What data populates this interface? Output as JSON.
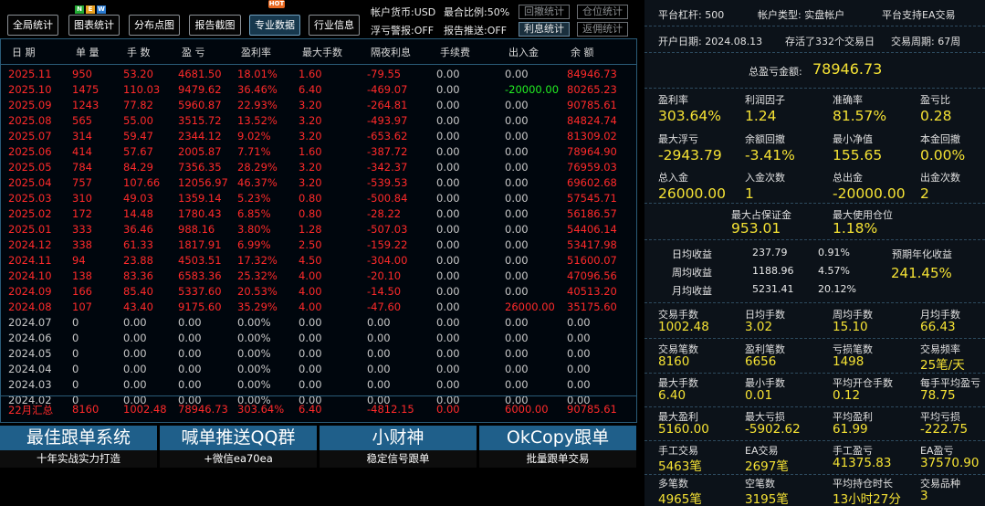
{
  "toolbar": {
    "buttons": [
      "全局统计",
      "图表统计",
      "分布点图",
      "报告截图",
      "专业数据",
      "行业信息"
    ],
    "active_index": 4,
    "new_badge": [
      "N",
      "E",
      "W"
    ],
    "hot_badge": "HOT",
    "currency": "帐户货币:USD",
    "ratio": "最合比例:50%",
    "float_warn": "浮亏警报:OFF",
    "report_push": "报告推送:OFF",
    "btn_test": "回撤统计",
    "btn_position": "仓位统计",
    "btn_interest": "利息统计",
    "btn_return": "返佣统计"
  },
  "table": {
    "headers": [
      "日 期",
      "单 量",
      "手 数",
      "盈 亏",
      "盈利率",
      "最大手数",
      "隔夜利息",
      "手续费",
      "出入金",
      "余 额"
    ],
    "rows": [
      [
        "2025.11",
        "950",
        "53.20",
        "4681.50",
        "18.01%",
        "1.60",
        "-79.55",
        "0.00",
        "0.00",
        "84946.73"
      ],
      [
        "2025.10",
        "1475",
        "110.03",
        "9479.62",
        "36.46%",
        "6.40",
        "-469.07",
        "0.00",
        "-20000.00",
        "80265.23"
      ],
      [
        "2025.09",
        "1243",
        "77.82",
        "5960.87",
        "22.93%",
        "3.20",
        "-264.81",
        "0.00",
        "0.00",
        "90785.61"
      ],
      [
        "2025.08",
        "565",
        "55.00",
        "3515.72",
        "13.52%",
        "3.20",
        "-493.97",
        "0.00",
        "0.00",
        "84824.74"
      ],
      [
        "2025.07",
        "314",
        "59.47",
        "2344.12",
        "9.02%",
        "3.20",
        "-653.62",
        "0.00",
        "0.00",
        "81309.02"
      ],
      [
        "2025.06",
        "414",
        "57.67",
        "2005.87",
        "7.71%",
        "1.60",
        "-387.72",
        "0.00",
        "0.00",
        "78964.90"
      ],
      [
        "2025.05",
        "784",
        "84.29",
        "7356.35",
        "28.29%",
        "3.20",
        "-342.37",
        "0.00",
        "0.00",
        "76959.03"
      ],
      [
        "2025.04",
        "757",
        "107.66",
        "12056.97",
        "46.37%",
        "3.20",
        "-539.53",
        "0.00",
        "0.00",
        "69602.68"
      ],
      [
        "2025.03",
        "310",
        "49.03",
        "1359.14",
        "5.23%",
        "0.80",
        "-500.84",
        "0.00",
        "0.00",
        "57545.71"
      ],
      [
        "2025.02",
        "172",
        "14.48",
        "1780.43",
        "6.85%",
        "0.80",
        "-28.22",
        "0.00",
        "0.00",
        "56186.57"
      ],
      [
        "2025.01",
        "333",
        "36.46",
        "988.16",
        "3.80%",
        "1.28",
        "-507.03",
        "0.00",
        "0.00",
        "54406.14"
      ],
      [
        "2024.12",
        "338",
        "61.33",
        "1817.91",
        "6.99%",
        "2.50",
        "-159.22",
        "0.00",
        "0.00",
        "53417.98"
      ],
      [
        "2024.11",
        "94",
        "23.88",
        "4503.51",
        "17.32%",
        "4.50",
        "-304.00",
        "0.00",
        "0.00",
        "51600.07"
      ],
      [
        "2024.10",
        "138",
        "83.36",
        "6583.36",
        "25.32%",
        "4.00",
        "-20.10",
        "0.00",
        "0.00",
        "47096.56"
      ],
      [
        "2024.09",
        "166",
        "85.40",
        "5337.60",
        "20.53%",
        "4.00",
        "-14.50",
        "0.00",
        "0.00",
        "40513.20"
      ],
      [
        "2024.08",
        "107",
        "43.40",
        "9175.60",
        "35.29%",
        "4.00",
        "-47.60",
        "0.00",
        "26000.00",
        "35175.60"
      ],
      [
        "2024.07",
        "0",
        "0.00",
        "0.00",
        "0.00%",
        "0.00",
        "0.00",
        "0.00",
        "0.00",
        "0.00"
      ],
      [
        "2024.06",
        "0",
        "0.00",
        "0.00",
        "0.00%",
        "0.00",
        "0.00",
        "0.00",
        "0.00",
        "0.00"
      ],
      [
        "2024.05",
        "0",
        "0.00",
        "0.00",
        "0.00%",
        "0.00",
        "0.00",
        "0.00",
        "0.00",
        "0.00"
      ],
      [
        "2024.04",
        "0",
        "0.00",
        "0.00",
        "0.00%",
        "0.00",
        "0.00",
        "0.00",
        "0.00",
        "0.00"
      ],
      [
        "2024.03",
        "0",
        "0.00",
        "0.00",
        "0.00%",
        "0.00",
        "0.00",
        "0.00",
        "0.00",
        "0.00"
      ],
      [
        "2024.02",
        "0",
        "0.00",
        "0.00",
        "0.00%",
        "0.00",
        "0.00",
        "0.00",
        "0.00",
        "0.00"
      ]
    ],
    "summary": [
      "22月汇总",
      "8160",
      "1002.48",
      "78946.73",
      "303.64%",
      "6.40",
      "-4812.15",
      "0.00",
      "6000.00",
      "90785.61"
    ]
  },
  "ads": [
    {
      "title": "最佳跟单系统",
      "sub": "十年实战实力打造"
    },
    {
      "title": "喊单推送QQ群",
      "sub": "+微信ea70ea"
    },
    {
      "title": "小财神",
      "sub": "稳定信号跟单"
    },
    {
      "title": "OkCopy跟单",
      "sub": "批量跟单交易"
    }
  ],
  "right": {
    "leverage": "平台杠杆:  500",
    "acct_type": "帐户类型:  实盘帐户",
    "ea_support": "平台支持EA交易",
    "open_date": "开户日期:  2024.08.13",
    "survived": "存活了332个交易日",
    "period": "交易周期:  67周",
    "total_profit_label": "总盈亏金额:",
    "total_profit": "78946.73",
    "stats1": [
      {
        "label": "盈利率",
        "value": "303.64%"
      },
      {
        "label": "利润因子",
        "value": "1.24"
      },
      {
        "label": "准确率",
        "value": "81.57%"
      },
      {
        "label": "盈亏比",
        "value": "0.28"
      },
      {
        "label": "最大浮亏",
        "value": "-2943.79"
      },
      {
        "label": "余额回撤",
        "value": "-3.41%"
      },
      {
        "label": "最小净值",
        "value": "155.65"
      },
      {
        "label": "本金回撤",
        "value": "0.00%"
      },
      {
        "label": "总入金",
        "value": "26000.00"
      },
      {
        "label": "入金次数",
        "value": "1"
      },
      {
        "label": "总出金",
        "value": "-20000.00"
      },
      {
        "label": "出金次数",
        "value": "2"
      }
    ],
    "margin": [
      {
        "label": "最大占保证金",
        "value": "953.01"
      },
      {
        "label": "最大使用仓位",
        "value": "1.18%"
      }
    ],
    "returns": [
      {
        "label": "日均收益",
        "amount": "237.79",
        "pct": "0.91%"
      },
      {
        "label": "周均收益",
        "amount": "1188.96",
        "pct": "4.57%"
      },
      {
        "label": "月均收益",
        "amount": "5231.41",
        "pct": "20.12%"
      }
    ],
    "annual_label": "预期年化收益",
    "annual_value": "241.45%",
    "stats2": [
      {
        "label": "交易手数",
        "value": "1002.48"
      },
      {
        "label": "日均手数",
        "value": "3.02"
      },
      {
        "label": "周均手数",
        "value": "15.10"
      },
      {
        "label": "月均手数",
        "value": "66.43"
      },
      {
        "label": "交易笔数",
        "value": "8160"
      },
      {
        "label": "盈利笔数",
        "value": "6656"
      },
      {
        "label": "亏损笔数",
        "value": "1498"
      },
      {
        "label": "交易频率",
        "value": "25笔/天"
      },
      {
        "label": "最大手数",
        "value": "6.40"
      },
      {
        "label": "最小手数",
        "value": "0.01"
      },
      {
        "label": "平均开仓手数",
        "value": "0.12"
      },
      {
        "label": "每手平均盈亏",
        "value": "78.75"
      },
      {
        "label": "最大盈利",
        "value": "5160.00"
      },
      {
        "label": "最大亏损",
        "value": "-5902.62"
      },
      {
        "label": "平均盈利",
        "value": "61.99"
      },
      {
        "label": "平均亏损",
        "value": "-222.75"
      },
      {
        "label": "手工交易",
        "value": "5463笔"
      },
      {
        "label": "EA交易",
        "value": "2697笔"
      },
      {
        "label": "手工盈亏",
        "value": "41375.83"
      },
      {
        "label": "EA盈亏",
        "value": "37570.90"
      },
      {
        "label": "多笔数",
        "value": "4965笔"
      },
      {
        "label": "空笔数",
        "value": "3195笔"
      },
      {
        "label": "平均持仓时长",
        "value": "13小时27分"
      },
      {
        "label": "交易品种",
        "value": "3"
      }
    ]
  }
}
